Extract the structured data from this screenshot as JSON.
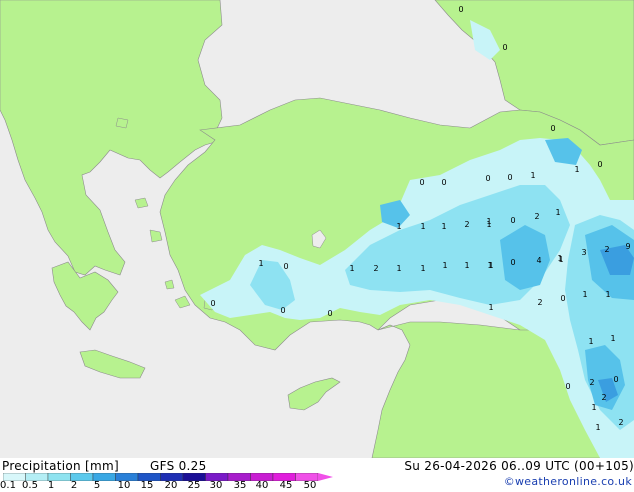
{
  "footer": {
    "legend_title": "Precipitation [mm]",
    "model_name": "GFS 0.25",
    "run_info": "Su 26-04-2026 06..09 UTC (00+105)",
    "credit": "©weatheronline.co.uk"
  },
  "legend": {
    "ticks": [
      "0.1",
      "0.5",
      "1",
      "2",
      "5",
      "10",
      "15",
      "20",
      "25",
      "30",
      "35",
      "40",
      "45",
      "50"
    ],
    "colors": [
      "#d8f7fa",
      "#b4eef5",
      "#8fe3f0",
      "#5cc9ec",
      "#3aa8e4",
      "#2a80d8",
      "#1f55c6",
      "#1f2fb4",
      "#1a0f96",
      "#7a1ac8",
      "#a81ecc",
      "#c81ed2",
      "#e01edc",
      "#f050e8"
    ]
  },
  "colors": {
    "land": "#b7f28f",
    "sea": "#ededed",
    "coast": "#8c8c8c",
    "precip_light": "#c8f4f8",
    "precip_medium": "#8ee2f2",
    "precip_heavy": "#56c2ea",
    "precip_strong": "#3a9ee0"
  },
  "map": {
    "labels": [
      {
        "id": "p01",
        "text": "0"
      },
      {
        "id": "p02",
        "text": "0"
      },
      {
        "id": "p03",
        "text": "0"
      },
      {
        "id": "p04",
        "text": "1"
      },
      {
        "id": "p05",
        "text": "0"
      },
      {
        "id": "p06",
        "text": "0"
      },
      {
        "id": "p07",
        "text": "0"
      },
      {
        "id": "p08",
        "text": "0"
      },
      {
        "id": "p09",
        "text": "0"
      },
      {
        "id": "p10",
        "text": "1"
      },
      {
        "id": "p11",
        "text": "1"
      },
      {
        "id": "p12",
        "text": "1"
      },
      {
        "id": "p13",
        "text": "1"
      },
      {
        "id": "p14",
        "text": "1"
      },
      {
        "id": "p15",
        "text": "1"
      },
      {
        "id": "p16",
        "text": "2"
      },
      {
        "id": "p17",
        "text": "1"
      },
      {
        "id": "p18",
        "text": "0"
      },
      {
        "id": "p19",
        "text": "2"
      },
      {
        "id": "p20",
        "text": "1"
      },
      {
        "id": "p21",
        "text": "2"
      },
      {
        "id": "p22",
        "text": "1"
      },
      {
        "id": "p23",
        "text": "1"
      },
      {
        "id": "p24",
        "text": "1"
      },
      {
        "id": "p25",
        "text": "1"
      },
      {
        "id": "p26",
        "text": "1"
      },
      {
        "id": "p27",
        "text": "1"
      },
      {
        "id": "p28",
        "text": "1"
      },
      {
        "id": "p29",
        "text": "0"
      },
      {
        "id": "p30",
        "text": "4"
      },
      {
        "id": "p31",
        "text": "1"
      },
      {
        "id": "p32",
        "text": "3"
      },
      {
        "id": "p33",
        "text": "2"
      },
      {
        "id": "p34",
        "text": "9"
      },
      {
        "id": "p35",
        "text": "1"
      },
      {
        "id": "p36",
        "text": "0"
      },
      {
        "id": "p37",
        "text": "0"
      },
      {
        "id": "p38",
        "text": "0"
      },
      {
        "id": "p39",
        "text": "0"
      },
      {
        "id": "p40",
        "text": "1"
      },
      {
        "id": "p41",
        "text": "2"
      },
      {
        "id": "p42",
        "text": "1"
      },
      {
        "id": "p43",
        "text": "0"
      },
      {
        "id": "p44",
        "text": "1"
      },
      {
        "id": "p45",
        "text": "0"
      },
      {
        "id": "p46",
        "text": "1"
      },
      {
        "id": "p47",
        "text": "1"
      },
      {
        "id": "p48",
        "text": "2"
      },
      {
        "id": "p49",
        "text": "0"
      },
      {
        "id": "p50",
        "text": "1"
      },
      {
        "id": "p51",
        "text": "2"
      },
      {
        "id": "p52",
        "text": "1"
      },
      {
        "id": "p53",
        "text": "2"
      }
    ]
  }
}
